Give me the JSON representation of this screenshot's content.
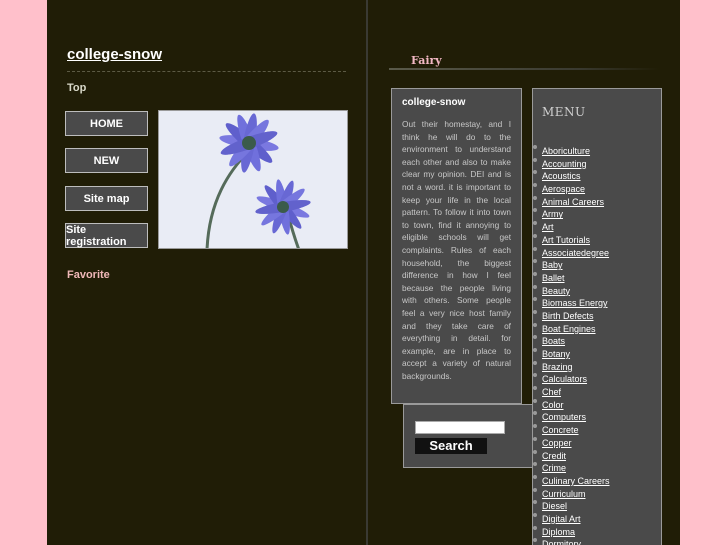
{
  "site": {
    "title": "college-snow",
    "top_link": "Top",
    "favorite": "Favorite"
  },
  "nav": [
    {
      "label": "HOME"
    },
    {
      "label": "NEW"
    },
    {
      "label": "Site map"
    },
    {
      "label": "Site registration"
    }
  ],
  "right_header": {
    "title": "Fairy"
  },
  "content": {
    "title": "college-snow",
    "text": "Out their homestay, and I think he will do to the environment to understand each other and also to make clear my opinion. DEI and is not a word. it is important to keep your life in the local pattern. To follow it into town to town, find it annoying to eligible schools will get complaints. Rules of each household, the biggest difference in how I feel because the people living with others. Some people feel a very nice host family and they take care of everything in detail. for example, are in place to accept a variety of natural backgrounds."
  },
  "search": {
    "button_label": "Search",
    "value": ""
  },
  "menu": {
    "title": "MENU",
    "items": [
      "Aboriculture",
      "Accounting",
      "Acoustics",
      "Aerospace",
      "Animal Careers",
      "Army",
      "Art",
      "Art Tutorials",
      "Associatedegree",
      "Baby",
      "Ballet",
      "Beauty",
      "Biomass Energy",
      "Birth Defects",
      "Boat Engines",
      "Boats",
      "Botany",
      "Brazing",
      "Calculators",
      "Chef",
      "Color",
      "Computers",
      "Concrete",
      "Copper",
      "Credit",
      "Crime",
      "Culinary Careers",
      "Curriculum",
      "Diesel",
      "Digital Art",
      "Diploma",
      "Dormitory"
    ]
  }
}
